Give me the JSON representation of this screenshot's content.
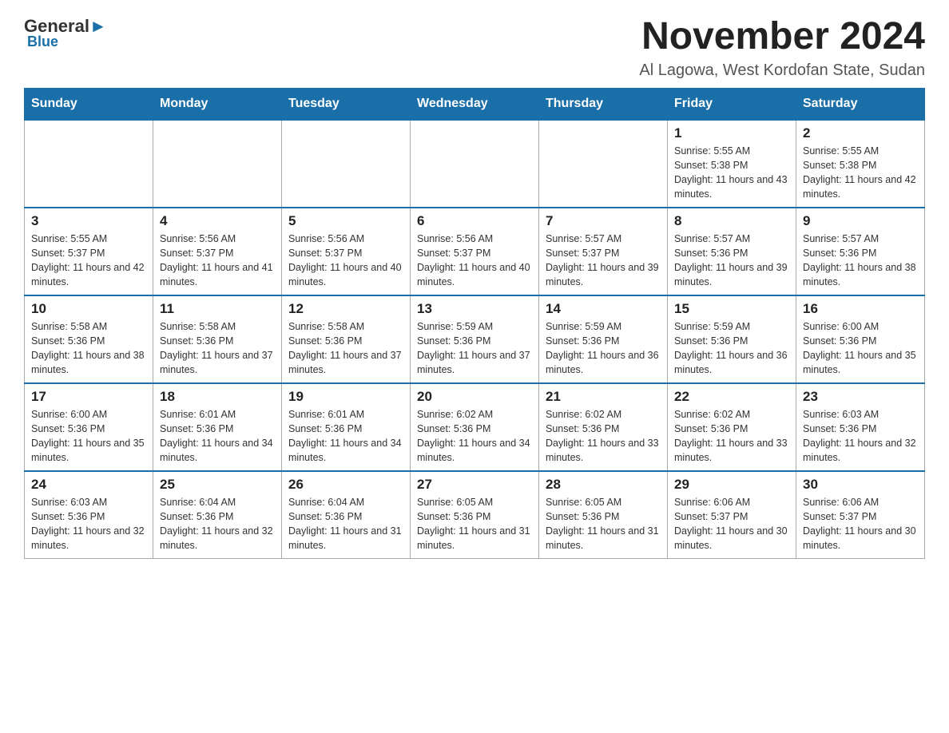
{
  "logo": {
    "general": "General",
    "blue": "Blue"
  },
  "title": "November 2024",
  "location": "Al Lagowa, West Kordofan State, Sudan",
  "days_header": [
    "Sunday",
    "Monday",
    "Tuesday",
    "Wednesday",
    "Thursday",
    "Friday",
    "Saturday"
  ],
  "weeks": [
    [
      {
        "day": "",
        "info": ""
      },
      {
        "day": "",
        "info": ""
      },
      {
        "day": "",
        "info": ""
      },
      {
        "day": "",
        "info": ""
      },
      {
        "day": "",
        "info": ""
      },
      {
        "day": "1",
        "info": "Sunrise: 5:55 AM\nSunset: 5:38 PM\nDaylight: 11 hours and 43 minutes."
      },
      {
        "day": "2",
        "info": "Sunrise: 5:55 AM\nSunset: 5:38 PM\nDaylight: 11 hours and 42 minutes."
      }
    ],
    [
      {
        "day": "3",
        "info": "Sunrise: 5:55 AM\nSunset: 5:37 PM\nDaylight: 11 hours and 42 minutes."
      },
      {
        "day": "4",
        "info": "Sunrise: 5:56 AM\nSunset: 5:37 PM\nDaylight: 11 hours and 41 minutes."
      },
      {
        "day": "5",
        "info": "Sunrise: 5:56 AM\nSunset: 5:37 PM\nDaylight: 11 hours and 40 minutes."
      },
      {
        "day": "6",
        "info": "Sunrise: 5:56 AM\nSunset: 5:37 PM\nDaylight: 11 hours and 40 minutes."
      },
      {
        "day": "7",
        "info": "Sunrise: 5:57 AM\nSunset: 5:37 PM\nDaylight: 11 hours and 39 minutes."
      },
      {
        "day": "8",
        "info": "Sunrise: 5:57 AM\nSunset: 5:36 PM\nDaylight: 11 hours and 39 minutes."
      },
      {
        "day": "9",
        "info": "Sunrise: 5:57 AM\nSunset: 5:36 PM\nDaylight: 11 hours and 38 minutes."
      }
    ],
    [
      {
        "day": "10",
        "info": "Sunrise: 5:58 AM\nSunset: 5:36 PM\nDaylight: 11 hours and 38 minutes."
      },
      {
        "day": "11",
        "info": "Sunrise: 5:58 AM\nSunset: 5:36 PM\nDaylight: 11 hours and 37 minutes."
      },
      {
        "day": "12",
        "info": "Sunrise: 5:58 AM\nSunset: 5:36 PM\nDaylight: 11 hours and 37 minutes."
      },
      {
        "day": "13",
        "info": "Sunrise: 5:59 AM\nSunset: 5:36 PM\nDaylight: 11 hours and 37 minutes."
      },
      {
        "day": "14",
        "info": "Sunrise: 5:59 AM\nSunset: 5:36 PM\nDaylight: 11 hours and 36 minutes."
      },
      {
        "day": "15",
        "info": "Sunrise: 5:59 AM\nSunset: 5:36 PM\nDaylight: 11 hours and 36 minutes."
      },
      {
        "day": "16",
        "info": "Sunrise: 6:00 AM\nSunset: 5:36 PM\nDaylight: 11 hours and 35 minutes."
      }
    ],
    [
      {
        "day": "17",
        "info": "Sunrise: 6:00 AM\nSunset: 5:36 PM\nDaylight: 11 hours and 35 minutes."
      },
      {
        "day": "18",
        "info": "Sunrise: 6:01 AM\nSunset: 5:36 PM\nDaylight: 11 hours and 34 minutes."
      },
      {
        "day": "19",
        "info": "Sunrise: 6:01 AM\nSunset: 5:36 PM\nDaylight: 11 hours and 34 minutes."
      },
      {
        "day": "20",
        "info": "Sunrise: 6:02 AM\nSunset: 5:36 PM\nDaylight: 11 hours and 34 minutes."
      },
      {
        "day": "21",
        "info": "Sunrise: 6:02 AM\nSunset: 5:36 PM\nDaylight: 11 hours and 33 minutes."
      },
      {
        "day": "22",
        "info": "Sunrise: 6:02 AM\nSunset: 5:36 PM\nDaylight: 11 hours and 33 minutes."
      },
      {
        "day": "23",
        "info": "Sunrise: 6:03 AM\nSunset: 5:36 PM\nDaylight: 11 hours and 32 minutes."
      }
    ],
    [
      {
        "day": "24",
        "info": "Sunrise: 6:03 AM\nSunset: 5:36 PM\nDaylight: 11 hours and 32 minutes."
      },
      {
        "day": "25",
        "info": "Sunrise: 6:04 AM\nSunset: 5:36 PM\nDaylight: 11 hours and 32 minutes."
      },
      {
        "day": "26",
        "info": "Sunrise: 6:04 AM\nSunset: 5:36 PM\nDaylight: 11 hours and 31 minutes."
      },
      {
        "day": "27",
        "info": "Sunrise: 6:05 AM\nSunset: 5:36 PM\nDaylight: 11 hours and 31 minutes."
      },
      {
        "day": "28",
        "info": "Sunrise: 6:05 AM\nSunset: 5:36 PM\nDaylight: 11 hours and 31 minutes."
      },
      {
        "day": "29",
        "info": "Sunrise: 6:06 AM\nSunset: 5:37 PM\nDaylight: 11 hours and 30 minutes."
      },
      {
        "day": "30",
        "info": "Sunrise: 6:06 AM\nSunset: 5:37 PM\nDaylight: 11 hours and 30 minutes."
      }
    ]
  ]
}
